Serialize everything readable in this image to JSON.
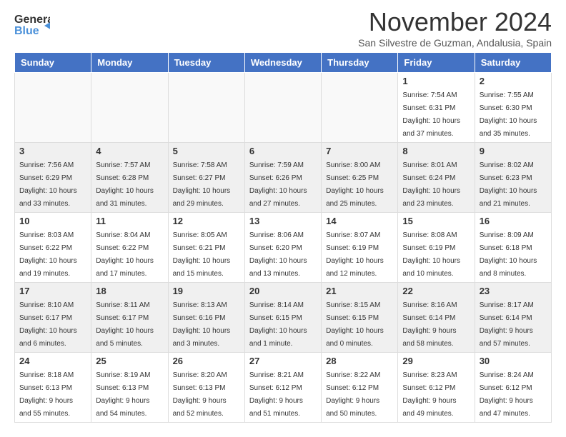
{
  "header": {
    "logo_line1": "General",
    "logo_line2": "Blue",
    "month": "November 2024",
    "location": "San Silvestre de Guzman, Andalusia, Spain"
  },
  "days_of_week": [
    "Sunday",
    "Monday",
    "Tuesday",
    "Wednesday",
    "Thursday",
    "Friday",
    "Saturday"
  ],
  "weeks": [
    [
      {
        "day": "",
        "sunrise": "",
        "sunset": "",
        "daylight": ""
      },
      {
        "day": "",
        "sunrise": "",
        "sunset": "",
        "daylight": ""
      },
      {
        "day": "",
        "sunrise": "",
        "sunset": "",
        "daylight": ""
      },
      {
        "day": "",
        "sunrise": "",
        "sunset": "",
        "daylight": ""
      },
      {
        "day": "",
        "sunrise": "",
        "sunset": "",
        "daylight": ""
      },
      {
        "day": "1",
        "sunrise": "Sunrise: 7:54 AM",
        "sunset": "Sunset: 6:31 PM",
        "daylight": "Daylight: 10 hours and 37 minutes."
      },
      {
        "day": "2",
        "sunrise": "Sunrise: 7:55 AM",
        "sunset": "Sunset: 6:30 PM",
        "daylight": "Daylight: 10 hours and 35 minutes."
      }
    ],
    [
      {
        "day": "3",
        "sunrise": "Sunrise: 7:56 AM",
        "sunset": "Sunset: 6:29 PM",
        "daylight": "Daylight: 10 hours and 33 minutes."
      },
      {
        "day": "4",
        "sunrise": "Sunrise: 7:57 AM",
        "sunset": "Sunset: 6:28 PM",
        "daylight": "Daylight: 10 hours and 31 minutes."
      },
      {
        "day": "5",
        "sunrise": "Sunrise: 7:58 AM",
        "sunset": "Sunset: 6:27 PM",
        "daylight": "Daylight: 10 hours and 29 minutes."
      },
      {
        "day": "6",
        "sunrise": "Sunrise: 7:59 AM",
        "sunset": "Sunset: 6:26 PM",
        "daylight": "Daylight: 10 hours and 27 minutes."
      },
      {
        "day": "7",
        "sunrise": "Sunrise: 8:00 AM",
        "sunset": "Sunset: 6:25 PM",
        "daylight": "Daylight: 10 hours and 25 minutes."
      },
      {
        "day": "8",
        "sunrise": "Sunrise: 8:01 AM",
        "sunset": "Sunset: 6:24 PM",
        "daylight": "Daylight: 10 hours and 23 minutes."
      },
      {
        "day": "9",
        "sunrise": "Sunrise: 8:02 AM",
        "sunset": "Sunset: 6:23 PM",
        "daylight": "Daylight: 10 hours and 21 minutes."
      }
    ],
    [
      {
        "day": "10",
        "sunrise": "Sunrise: 8:03 AM",
        "sunset": "Sunset: 6:22 PM",
        "daylight": "Daylight: 10 hours and 19 minutes."
      },
      {
        "day": "11",
        "sunrise": "Sunrise: 8:04 AM",
        "sunset": "Sunset: 6:22 PM",
        "daylight": "Daylight: 10 hours and 17 minutes."
      },
      {
        "day": "12",
        "sunrise": "Sunrise: 8:05 AM",
        "sunset": "Sunset: 6:21 PM",
        "daylight": "Daylight: 10 hours and 15 minutes."
      },
      {
        "day": "13",
        "sunrise": "Sunrise: 8:06 AM",
        "sunset": "Sunset: 6:20 PM",
        "daylight": "Daylight: 10 hours and 13 minutes."
      },
      {
        "day": "14",
        "sunrise": "Sunrise: 8:07 AM",
        "sunset": "Sunset: 6:19 PM",
        "daylight": "Daylight: 10 hours and 12 minutes."
      },
      {
        "day": "15",
        "sunrise": "Sunrise: 8:08 AM",
        "sunset": "Sunset: 6:19 PM",
        "daylight": "Daylight: 10 hours and 10 minutes."
      },
      {
        "day": "16",
        "sunrise": "Sunrise: 8:09 AM",
        "sunset": "Sunset: 6:18 PM",
        "daylight": "Daylight: 10 hours and 8 minutes."
      }
    ],
    [
      {
        "day": "17",
        "sunrise": "Sunrise: 8:10 AM",
        "sunset": "Sunset: 6:17 PM",
        "daylight": "Daylight: 10 hours and 6 minutes."
      },
      {
        "day": "18",
        "sunrise": "Sunrise: 8:11 AM",
        "sunset": "Sunset: 6:17 PM",
        "daylight": "Daylight: 10 hours and 5 minutes."
      },
      {
        "day": "19",
        "sunrise": "Sunrise: 8:13 AM",
        "sunset": "Sunset: 6:16 PM",
        "daylight": "Daylight: 10 hours and 3 minutes."
      },
      {
        "day": "20",
        "sunrise": "Sunrise: 8:14 AM",
        "sunset": "Sunset: 6:15 PM",
        "daylight": "Daylight: 10 hours and 1 minute."
      },
      {
        "day": "21",
        "sunrise": "Sunrise: 8:15 AM",
        "sunset": "Sunset: 6:15 PM",
        "daylight": "Daylight: 10 hours and 0 minutes."
      },
      {
        "day": "22",
        "sunrise": "Sunrise: 8:16 AM",
        "sunset": "Sunset: 6:14 PM",
        "daylight": "Daylight: 9 hours and 58 minutes."
      },
      {
        "day": "23",
        "sunrise": "Sunrise: 8:17 AM",
        "sunset": "Sunset: 6:14 PM",
        "daylight": "Daylight: 9 hours and 57 minutes."
      }
    ],
    [
      {
        "day": "24",
        "sunrise": "Sunrise: 8:18 AM",
        "sunset": "Sunset: 6:13 PM",
        "daylight": "Daylight: 9 hours and 55 minutes."
      },
      {
        "day": "25",
        "sunrise": "Sunrise: 8:19 AM",
        "sunset": "Sunset: 6:13 PM",
        "daylight": "Daylight: 9 hours and 54 minutes."
      },
      {
        "day": "26",
        "sunrise": "Sunrise: 8:20 AM",
        "sunset": "Sunset: 6:13 PM",
        "daylight": "Daylight: 9 hours and 52 minutes."
      },
      {
        "day": "27",
        "sunrise": "Sunrise: 8:21 AM",
        "sunset": "Sunset: 6:12 PM",
        "daylight": "Daylight: 9 hours and 51 minutes."
      },
      {
        "day": "28",
        "sunrise": "Sunrise: 8:22 AM",
        "sunset": "Sunset: 6:12 PM",
        "daylight": "Daylight: 9 hours and 50 minutes."
      },
      {
        "day": "29",
        "sunrise": "Sunrise: 8:23 AM",
        "sunset": "Sunset: 6:12 PM",
        "daylight": "Daylight: 9 hours and 49 minutes."
      },
      {
        "day": "30",
        "sunrise": "Sunrise: 8:24 AM",
        "sunset": "Sunset: 6:12 PM",
        "daylight": "Daylight: 9 hours and 47 minutes."
      }
    ]
  ]
}
